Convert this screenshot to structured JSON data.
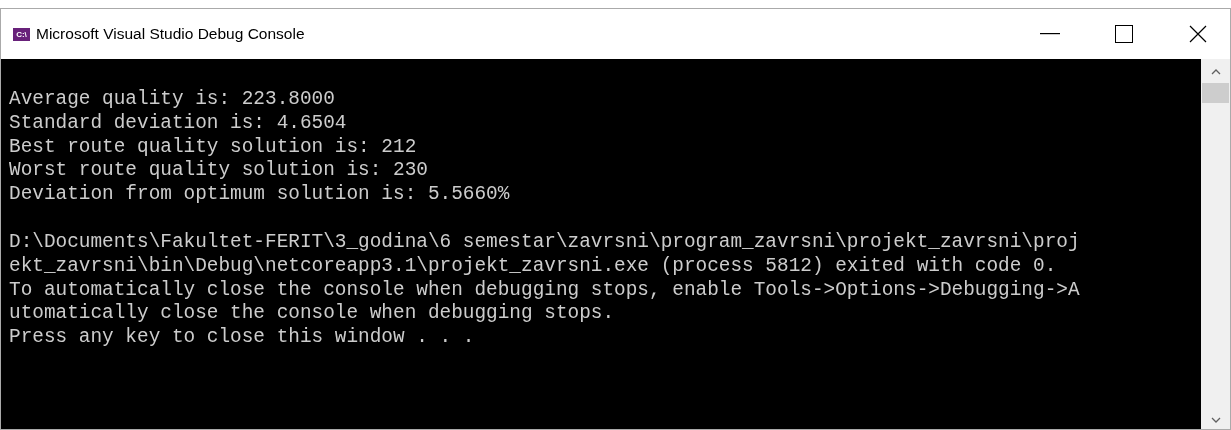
{
  "window": {
    "title": "Microsoft Visual Studio Debug Console",
    "icon_text": "C:\\"
  },
  "console": {
    "blocks": [
      [
        "Average quality is: 223.8000",
        "Standard deviation is: 4.6504",
        "Best route quality solution is: 212",
        "Worst route quality solution is: 230",
        "Deviation from optimum solution is: 5.5660%"
      ],
      [
        "D:\\Documents\\Fakultet-FERIT\\3_godina\\6 semestar\\zavrsni\\program_zavrsni\\projekt_zavrsni\\proj",
        "ekt_zavrsni\\bin\\Debug\\netcoreapp3.1\\projekt_zavrsni.exe (process 5812) exited with code 0.",
        "To automatically close the console when debugging stops, enable Tools->Options->Debugging->A",
        "utomatically close the console when debugging stops.",
        "Press any key to close this window . . ."
      ]
    ]
  }
}
